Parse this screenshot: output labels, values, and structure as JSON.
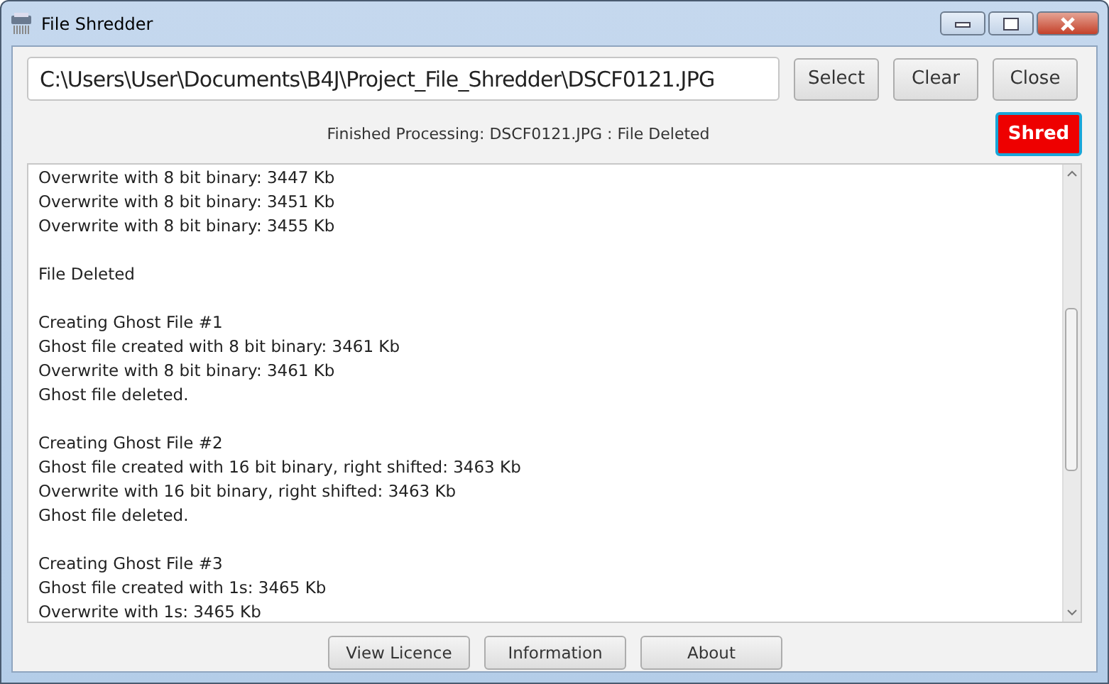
{
  "window": {
    "title": "File Shredder"
  },
  "path_field": {
    "value": "C:\\Users\\User\\Documents\\B4J\\Project_File_Shredder\\DSCF0121.JPG"
  },
  "top_buttons": [
    "Select",
    "Clear",
    "Close"
  ],
  "status": "Finished Processing: DSCF0121.JPG : File Deleted",
  "shred_button": {
    "label": "Shred",
    "focused": true
  },
  "log": [
    [
      "Overwrite with 8 bit binary: 3447 Kb",
      "Overwrite with 8 bit binary: 3451 Kb",
      "Overwrite with 8 bit binary: 3455 Kb"
    ],
    [
      "File Deleted"
    ],
    [
      "Creating Ghost File #1",
      "Ghost file created with 8 bit binary: 3461 Kb",
      "Overwrite with 8 bit binary: 3461 Kb",
      "Ghost file deleted."
    ],
    [
      "Creating Ghost File #2",
      "Ghost file created with 16 bit binary, right shifted: 3463 Kb",
      "Overwrite with 16 bit binary, right shifted: 3463 Kb",
      "Ghost file deleted."
    ],
    [
      "Creating Ghost File #3",
      "Ghost file created with 1s: 3465 Kb",
      "Overwrite with 1s: 3465 Kb"
    ]
  ],
  "bottom_buttons": [
    "View Licence",
    "Information",
    "About"
  ]
}
